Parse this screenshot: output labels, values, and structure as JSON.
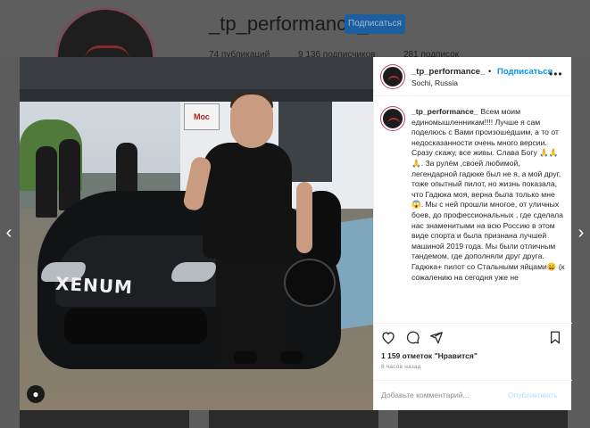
{
  "profile": {
    "username": "_tp_performance_",
    "subscribe_label": "Подписаться",
    "stats": [
      "74 публикаций",
      "9 136 подписчиков",
      "281 подписок"
    ]
  },
  "post": {
    "username": "_tp_performance_",
    "separator": "•",
    "follow_label": "Подписаться",
    "location": "Sochi, Russia",
    "more_icon": "more-horizontal-icon",
    "photo_text": {
      "car_brand": "XENUM",
      "sign": "Мос"
    },
    "caption": "Всем моим единомышленникам!!!! Лучше я сам поделюсь с Вами произошедшим, а то от недосказанности очень много версии.",
    "caption_2": "Сразу скажу, все живы. Слава Богу 🙏🙏🙏. За рулём ,своей любимой, легендарной гадюке был не я, а мой друг, тоже опытный пилот, но жизнь показала, что Гадюка моя, верна была только мне😱. Мы с ней прошли многое, от уличных боев, до профессиональных , где сделала нас знаменитыми на всю Россию в этом виде спорта и была признана лучшей машиной 2019 года. Мы были отличным тандемом, где дополняли друг друга. Гадюка+ пилот со Стальными яйцами😄 (к сожалению на сегодня уже не",
    "likes_count": "1 159 отметок",
    "likes_label": "\"Нравится\"",
    "time_ago": "8 часов назад",
    "comment_placeholder": "Добавьте комментарий...",
    "post_label": "Опубликовать"
  },
  "colors": {
    "accent": "#0095f6",
    "post_disabled": "#b2dffc",
    "backdrop": "#5c5c5c"
  }
}
